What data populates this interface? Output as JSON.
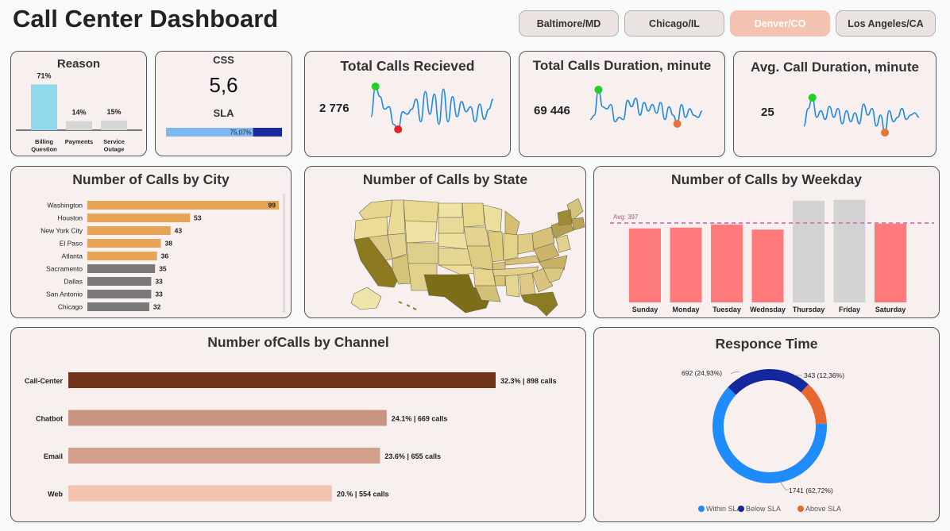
{
  "title": "Call Center Dashboard",
  "cities": [
    {
      "label": "Baltimore/MD",
      "active": false
    },
    {
      "label": "Chicago/IL",
      "active": false
    },
    {
      "label": "Denver/CO",
      "active": true
    },
    {
      "label": "Los Angeles/CA",
      "active": false
    }
  ],
  "colors": {
    "accent_blue": "#1e88e5",
    "dark_blue": "#1a2a9c",
    "light_blue": "#7fb8f0",
    "orange": "#e6a456",
    "gray": "#7a7878",
    "coral": "#ff7b7b",
    "light_gray": "#d3d3d3",
    "brown": "#73341c",
    "green": "#22d028",
    "red": "#e8202a"
  },
  "css": {
    "label": "CSS",
    "value": "5,6"
  },
  "sla": {
    "label": "SLA",
    "value_text": "75,07%",
    "value": 75.07
  },
  "kpis": [
    {
      "title": "Total Calls Recieved",
      "value": "2 776"
    },
    {
      "title": "Total Calls Duration, minute",
      "value": "69 446"
    },
    {
      "title": "Avg. Call Duration, minute",
      "value": "25"
    }
  ],
  "state_map": {
    "title": "Number of Calls by State"
  },
  "chart_data": [
    {
      "type": "bar",
      "title": "Reason",
      "categories": [
        "Billing Question",
        "Payments",
        "Service Outage"
      ],
      "values": [
        71,
        14,
        15
      ],
      "labels": [
        "71%",
        "14%",
        "15%"
      ],
      "ylim": [
        0,
        100
      ]
    },
    {
      "type": "bar",
      "orientation": "horizontal",
      "title": "Number of Calls by City",
      "categories": [
        "Washington",
        "Houston",
        "New York City",
        "El Paso",
        "Atlanta",
        "Sacramento",
        "Dallas",
        "San Antonio",
        "Chicago"
      ],
      "values": [
        99,
        53,
        43,
        38,
        36,
        35,
        33,
        33,
        32
      ]
    },
    {
      "type": "bar",
      "title": "Number of Calls by Weekday",
      "categories": [
        "Sunday",
        "Monday",
        "Tuesday",
        "Wednsday",
        "Thursday",
        "Friday",
        "Saturday"
      ],
      "values": [
        370,
        374,
        390,
        364,
        509,
        513,
        394
      ],
      "ylim": [
        0,
        520
      ],
      "avg_label": "Avg: 397",
      "avg": 397
    },
    {
      "type": "bar",
      "orientation": "horizontal",
      "title": "Number ofCalls by Channel",
      "categories": [
        "Call-Center",
        "Chatbot",
        "Email",
        "Web"
      ],
      "values": [
        898,
        669,
        655,
        554
      ],
      "labels": [
        "32.3% | 898 calls",
        "24.1% | 669 calls",
        "23.6% | 655 calls",
        "20.% | 554 calls"
      ],
      "colors": [
        "#73341c",
        "#c99582",
        "#d3a08c",
        "#f3c2b0"
      ]
    },
    {
      "type": "pie",
      "title": "Responce Time",
      "categories": [
        "Within SLA",
        "Below SLA",
        "Above SLA"
      ],
      "values": [
        1741,
        692,
        343
      ],
      "labels": [
        "1741 (62,72%)",
        "692 (24,93%)",
        "343 (12,36%)"
      ],
      "colors": [
        "#1e8cff",
        "#15279c",
        "#e5692f"
      ]
    },
    {
      "type": "line",
      "title": "Total Calls Recieved",
      "values": [
        6,
        18,
        14,
        9,
        10,
        3,
        1,
        8,
        7,
        9,
        13,
        4,
        16,
        7,
        15,
        3,
        17,
        4,
        14,
        6,
        12,
        8,
        10,
        4,
        11,
        5,
        9,
        13
      ]
    },
    {
      "type": "line",
      "title": "Total Calls Duration, minute",
      "values": [
        4,
        6,
        18,
        10,
        9,
        11,
        3,
        5,
        4,
        13,
        10,
        14,
        6,
        12,
        8,
        11,
        7,
        12,
        4,
        10,
        6,
        2,
        11,
        5,
        9,
        6,
        5,
        8
      ]
    },
    {
      "type": "line",
      "title": "Avg. Call Duration, minute",
      "values": [
        5,
        13,
        18,
        9,
        12,
        8,
        14,
        9,
        13,
        6,
        12,
        7,
        11,
        6,
        15,
        10,
        13,
        5,
        10,
        2,
        12,
        7,
        9,
        13,
        8,
        10,
        11,
        9
      ]
    }
  ]
}
